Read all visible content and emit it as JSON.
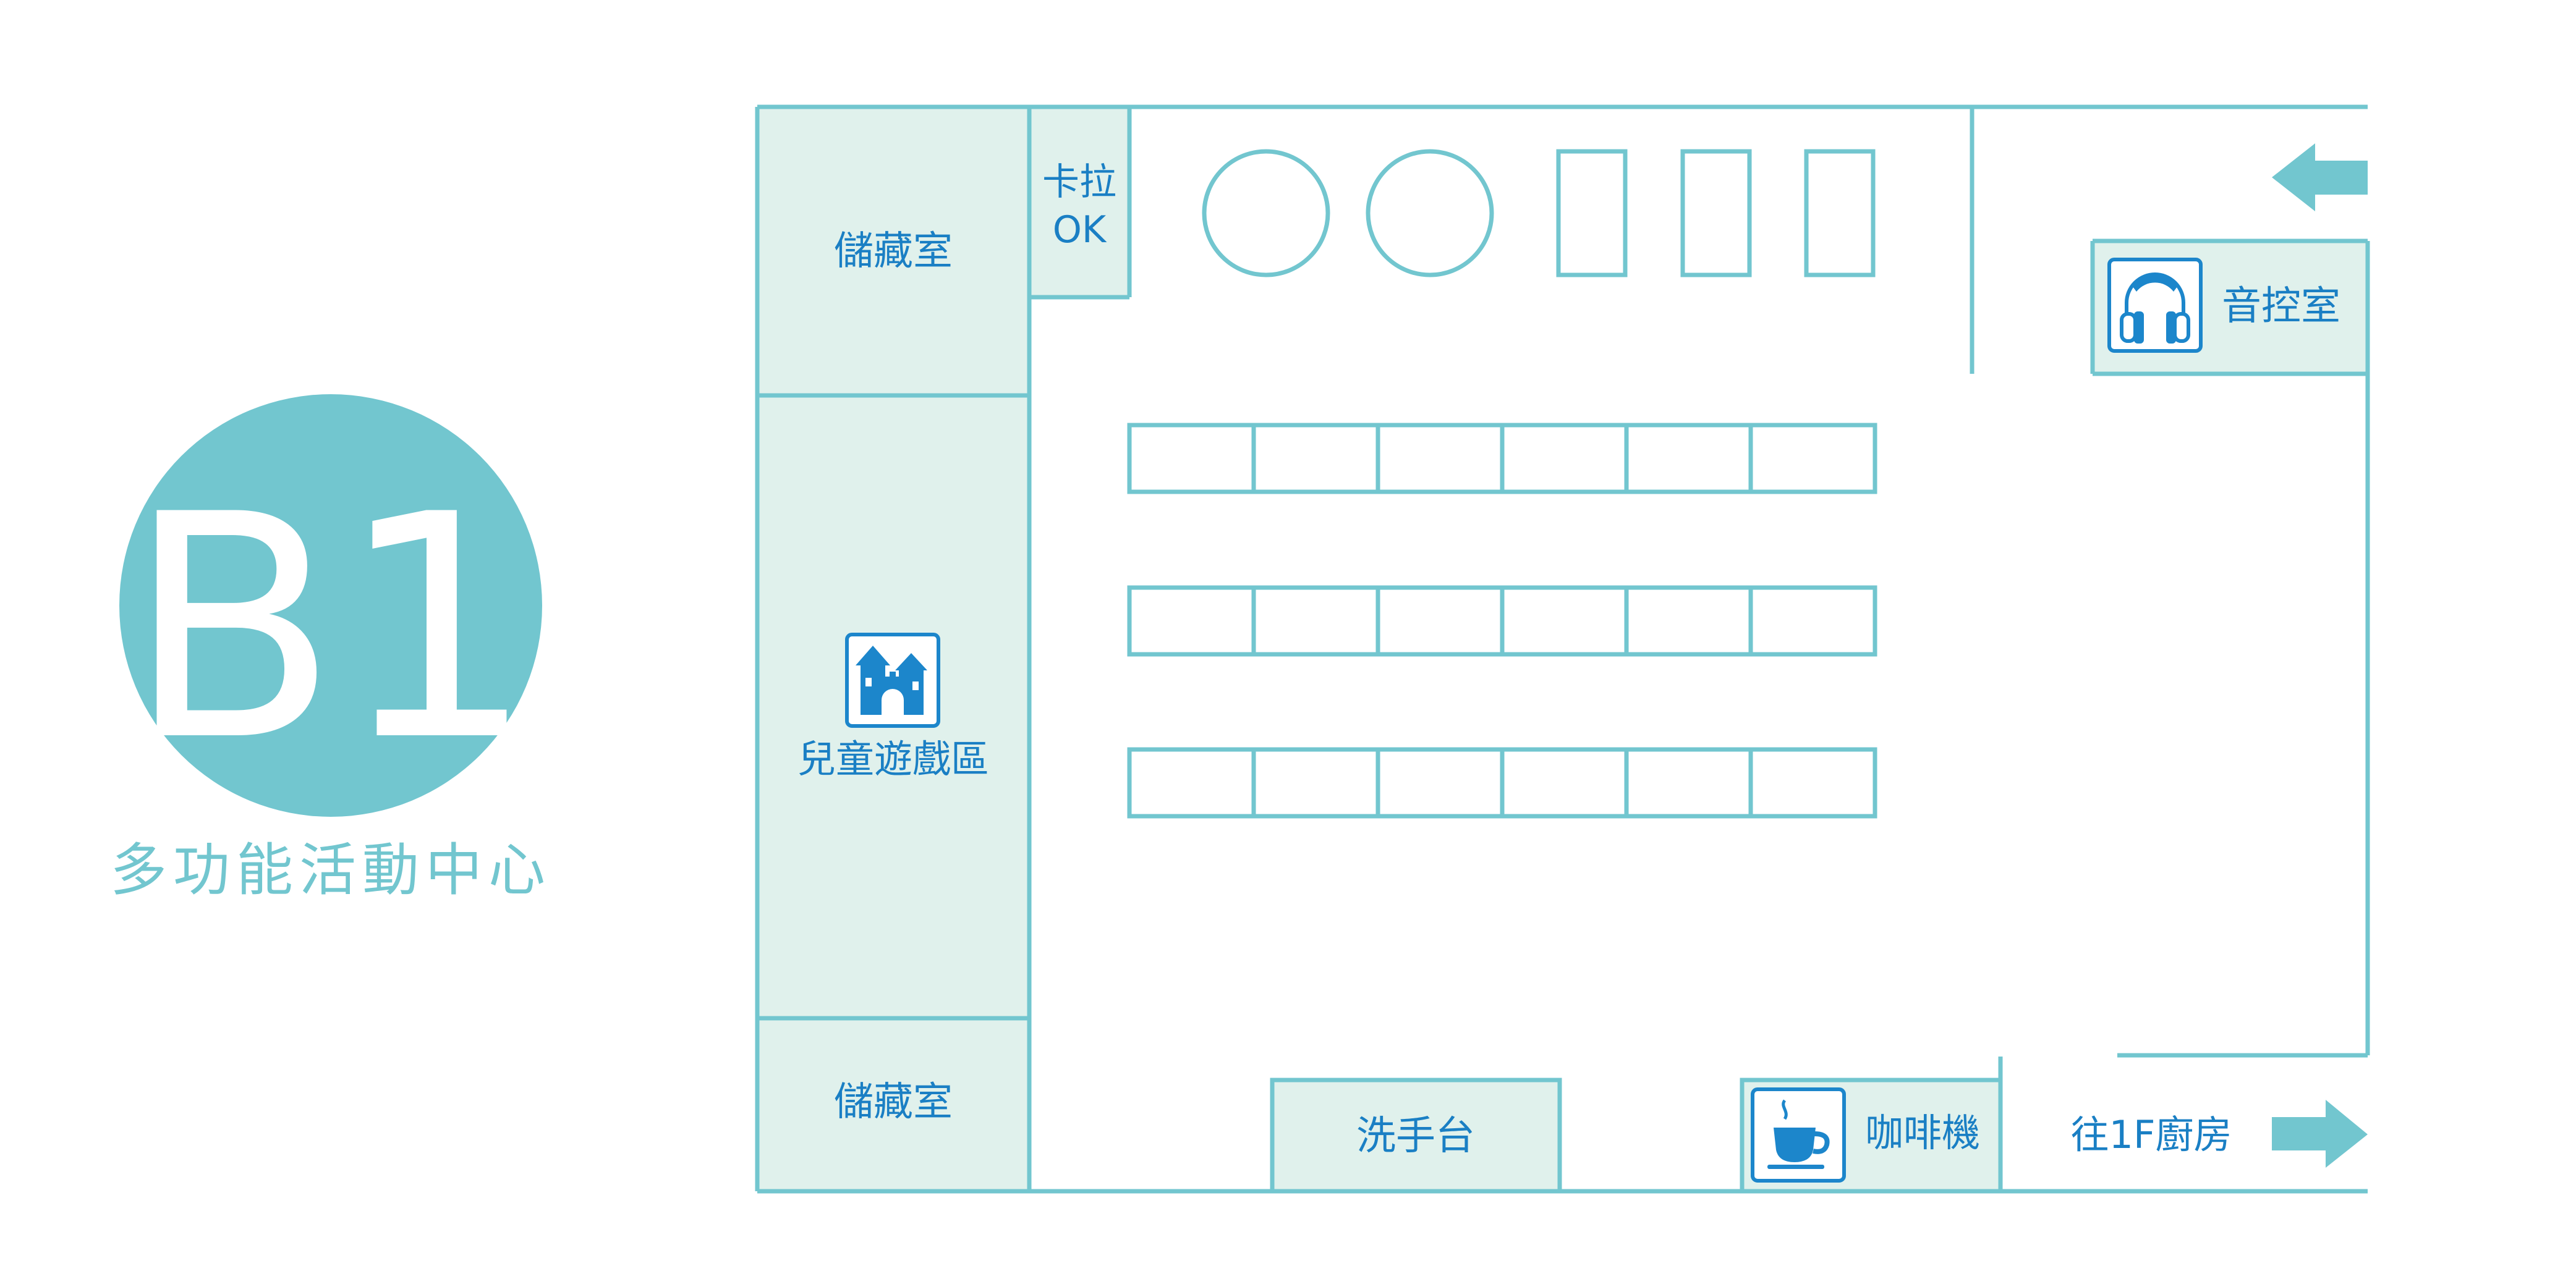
{
  "colors": {
    "teal": "#72C6CF",
    "room_fill": "#E0F1EC",
    "label_blue": "#1A7FC4",
    "icon_blue": "#1C86CB",
    "white": "#FFFFFF"
  },
  "badge": {
    "floor": "B1",
    "subtitle": "多功能活動中心"
  },
  "rooms": {
    "storage_top": "儲藏室",
    "karaoke_line1": "卡拉",
    "karaoke_line2": "OK",
    "playroom": "兒童遊戲區",
    "storage_bottom": "儲藏室",
    "sink": "洗手台",
    "coffee": "咖啡機",
    "sound_room": "音控室"
  },
  "directions": {
    "to_kitchen": "往1F廚房"
  },
  "icons": {
    "playroom": "castle-icon",
    "coffee": "coffee-cup-icon",
    "sound_room": "headphones-icon",
    "entrance": "arrow-left-icon",
    "exit": "arrow-right-icon"
  }
}
